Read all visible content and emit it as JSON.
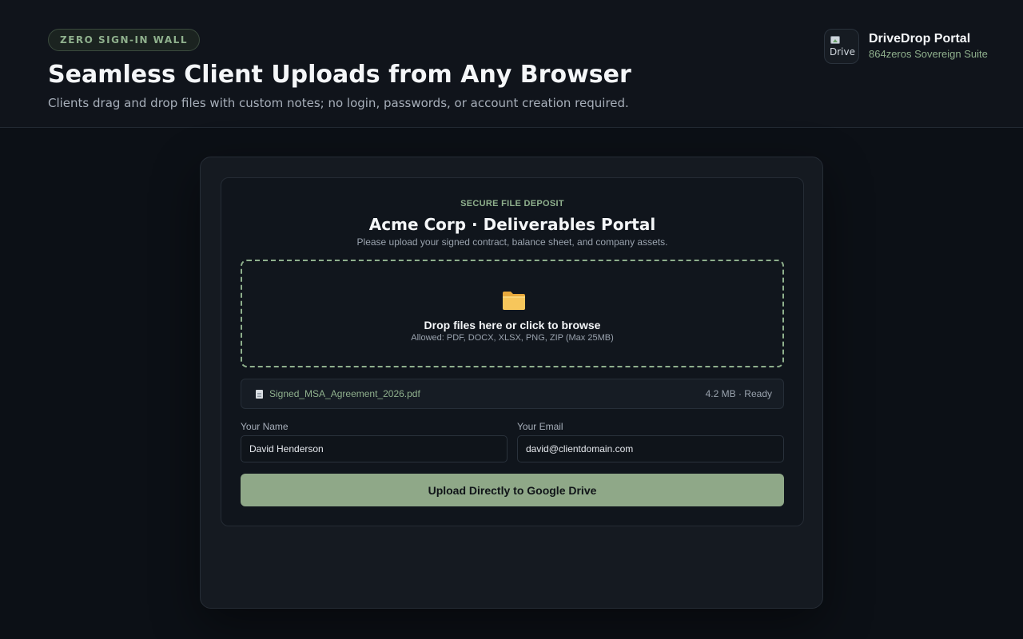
{
  "header": {
    "badge": "ZERO SIGN-IN WALL",
    "title": "Seamless Client Uploads from Any Browser",
    "subtitle": "Clients drag and drop files with custom notes; no login, passwords, or account creation required."
  },
  "brand": {
    "logo_alt": "Drive",
    "name": "DriveDrop Portal",
    "suite": "864zeros Sovereign Suite"
  },
  "portal": {
    "eyebrow": "SECURE FILE DEPOSIT",
    "title": "Acme Corp · Deliverables Portal",
    "subtitle": "Please upload your signed contract, balance sheet, and company assets.",
    "dropzone": {
      "icon": "folder-icon",
      "title": "Drop files here or click to browse",
      "hint": "Allowed: PDF, DOCX, XLSX, PNG, ZIP (Max 25MB)"
    },
    "file": {
      "icon": "file-icon",
      "name": "Signed_MSA_Agreement_2026.pdf",
      "status": "4.2 MB · Ready"
    },
    "form": {
      "name_label": "Your Name",
      "name_value": "David Henderson",
      "email_label": "Your Email",
      "email_value": "david@clientdomain.com"
    },
    "upload_label": "Upload Directly to Google Drive"
  },
  "colors": {
    "accent": "#8fb08d",
    "button": "#8fa888",
    "background": "#0c1016"
  }
}
